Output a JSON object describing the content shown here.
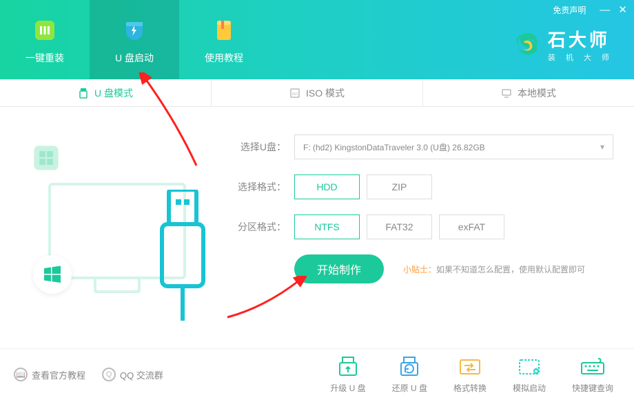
{
  "header": {
    "disclaimer": "免责声明",
    "nav": [
      {
        "label": "一键重装",
        "icon": "bars-icon"
      },
      {
        "label": "U 盘启动",
        "icon": "shield-bolt-icon"
      },
      {
        "label": "使用教程",
        "icon": "book-icon"
      }
    ],
    "logo": {
      "title": "石大师",
      "subtitle": "装 机 大 师"
    }
  },
  "mode_tabs": [
    {
      "label": "U 盘模式",
      "icon": "usb-icon",
      "active": true
    },
    {
      "label": "ISO 模式",
      "icon": "iso-icon",
      "active": false
    },
    {
      "label": "本地模式",
      "icon": "monitor-icon",
      "active": false
    }
  ],
  "form": {
    "disk_label": "选择U盘：",
    "disk_value": "F: (hd2) KingstonDataTraveler 3.0 (U盘) 26.82GB",
    "format_label": "选择格式：",
    "format_options": [
      "HDD",
      "ZIP"
    ],
    "format_selected": "HDD",
    "partition_label": "分区格式：",
    "partition_options": [
      "NTFS",
      "FAT32",
      "exFAT"
    ],
    "partition_selected": "NTFS",
    "submit": "开始制作",
    "tip_label": "小贴士：",
    "tip_text": "如果不知道怎么配置，使用默认配置即可"
  },
  "bottom": {
    "help_links": [
      {
        "label": "查看官方教程",
        "icon": "book"
      },
      {
        "label": "QQ 交流群",
        "icon": "qq"
      }
    ],
    "tools": [
      {
        "label": "升级 U 盘",
        "color": "#1bc99a"
      },
      {
        "label": "还原 U 盘",
        "color": "#3aa5e8"
      },
      {
        "label": "格式转换",
        "color": "#f5b945"
      },
      {
        "label": "模拟启动",
        "color": "#26d4c4"
      },
      {
        "label": "快捷键查询",
        "color": "#1bc99a"
      }
    ]
  }
}
